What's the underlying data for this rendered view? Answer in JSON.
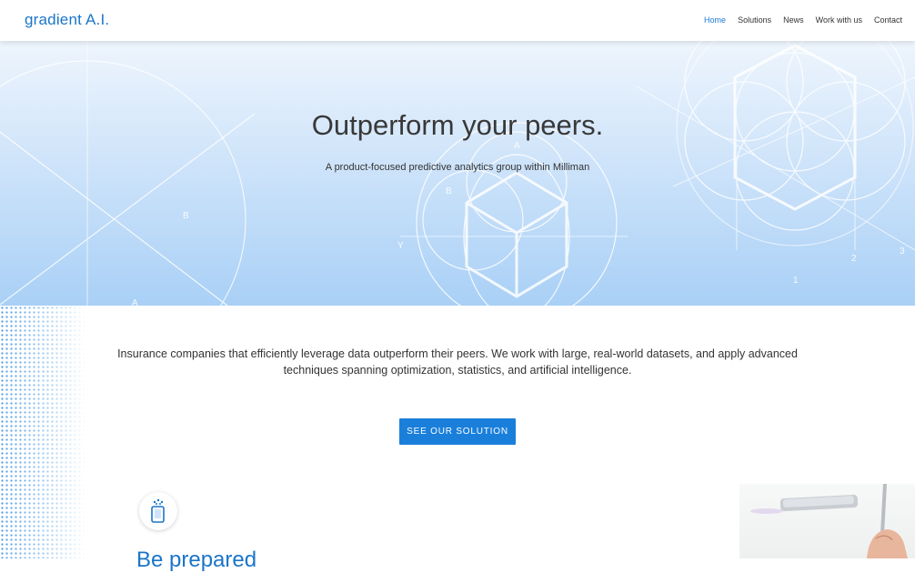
{
  "header": {
    "logo": "gradient A.I.",
    "nav": [
      {
        "label": "Home",
        "active": true
      },
      {
        "label": "Solutions"
      },
      {
        "label": "News"
      },
      {
        "label": "Work with us"
      },
      {
        "label": "Contact"
      }
    ]
  },
  "hero": {
    "title": "Outperform your peers.",
    "subtitle": "A product-focused predictive analytics group within Milliman",
    "diagram_labels": [
      "A",
      "B",
      "B",
      "Y",
      "A",
      "1",
      "2",
      "3"
    ]
  },
  "intro": {
    "text": "Insurance companies that efficiently leverage data outperform their peers. We work with large, real-world datasets, and apply advanced techniques spanning optimization, statistics, and artificial intelligence."
  },
  "cta": {
    "label": "SEE OUR SOLUTION"
  },
  "feature": {
    "heading": "Be prepared"
  },
  "colors": {
    "accent": "#1a7fdb",
    "brand": "#1b75c8"
  }
}
